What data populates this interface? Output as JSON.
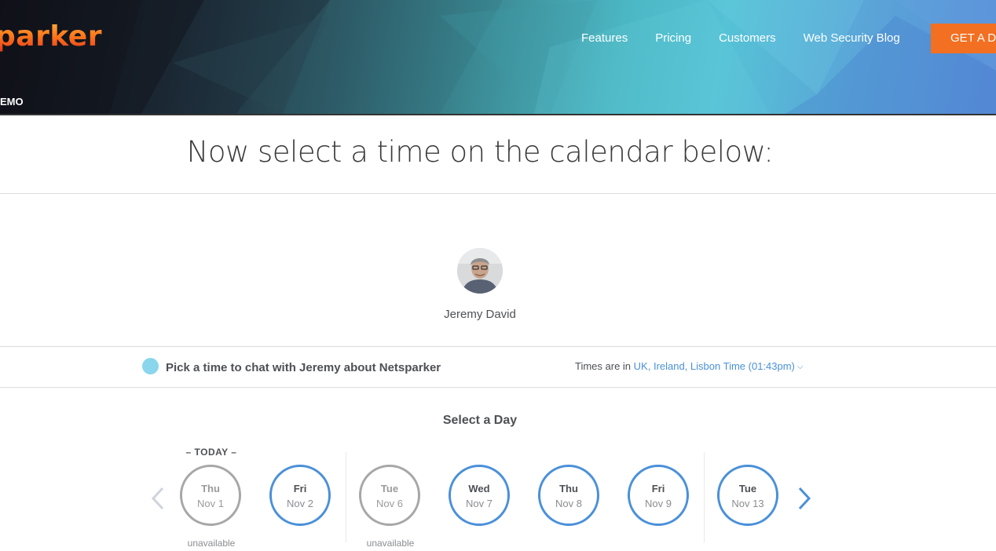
{
  "header": {
    "logo_text": "parker",
    "demo_tag": "EMO",
    "nav": [
      "Features",
      "Pricing",
      "Customers",
      "Web Security Blog"
    ],
    "cta_label": "GET A DEMO"
  },
  "headline": "Now select a time on the calendar below:",
  "host": {
    "name": "Jeremy David"
  },
  "event": {
    "title": "Pick a time to chat with Jeremy about Netsparker",
    "tz_prefix": "Times are in",
    "tz_value": "UK, Ireland, Lisbon Time (01:43pm)"
  },
  "calendar": {
    "heading": "Select a Day",
    "today_label": "– TODAY –",
    "unavailable_label": "unavailable",
    "days": [
      {
        "dow": "Thu",
        "date": "Nov 1",
        "available": false
      },
      {
        "dow": "Fri",
        "date": "Nov 2",
        "available": true
      },
      {
        "dow": "Tue",
        "date": "Nov 6",
        "available": false
      },
      {
        "dow": "Wed",
        "date": "Nov 7",
        "available": true
      },
      {
        "dow": "Thu",
        "date": "Nov 8",
        "available": true
      },
      {
        "dow": "Fri",
        "date": "Nov 9",
        "available": true
      },
      {
        "dow": "Tue",
        "date": "Nov 13",
        "available": true
      }
    ]
  },
  "colors": {
    "accent_blue": "#4a90d9",
    "cta_orange": "#f36f21",
    "event_dot": "#8ad6ec",
    "unavailable_gray": "#a7a7a7"
  },
  "icons": {
    "prev": "chevron-left-icon",
    "next": "chevron-right-icon",
    "tz_dropdown": "chevron-down-icon"
  }
}
